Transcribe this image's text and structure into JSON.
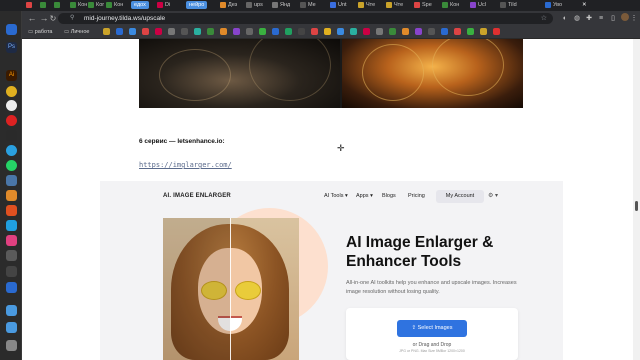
{
  "browser": {
    "tabs": [
      {
        "label": "Кон",
        "color": "#d44"
      },
      {
        "label": "Ког",
        "color": "#3a8a3a"
      },
      {
        "label": "Кон",
        "color": "#3a8a3a"
      },
      {
        "label": "едох",
        "color": "#4a8fe0"
      },
      {
        "label": "Di",
        "color": "#c04"
      },
      {
        "label": "нейро",
        "color": "#4a8fe0"
      },
      {
        "label": "Дез",
        "color": "#e08a2a"
      },
      {
        "label": "ups",
        "color": "#666"
      },
      {
        "label": "Янд",
        "color": "#777"
      },
      {
        "label": "Ме",
        "color": "#555"
      },
      {
        "label": "Unt",
        "color": "#3a6ee0"
      },
      {
        "label": "Чте",
        "color": "#caa32a"
      },
      {
        "label": "Чте",
        "color": "#caa32a"
      },
      {
        "label": "Spe",
        "color": "#d44"
      },
      {
        "label": "Кон",
        "color": "#3a8a3a"
      },
      {
        "label": "Ucl",
        "color": "#8844cc"
      },
      {
        "label": "Tild",
        "color": "#555"
      },
      {
        "label": "Уво",
        "color": "#2a6ad0"
      }
    ],
    "url": "mid-journey.tilda.ws/upscale",
    "bookmarks": [
      "работа",
      "Личное"
    ]
  },
  "page": {
    "heading": "6 сервис — letsenhance.io:",
    "link": "https://imglarger.com/",
    "screenshot": {
      "logo": "AI. IMAGE ENLARGER",
      "nav": [
        "AI Tools ▾",
        "Apps ▾",
        "Blogs",
        "Pricing"
      ],
      "account": "My Account",
      "lang": "⚙ ▾",
      "title": "AI Image Enlarger & Enhancer Tools",
      "subtitle": "All-in-one AI toolkits help you enhance and upscale images. Increases image resolution without losing quality.",
      "select_button": "⇪  Select Images",
      "drop_text": "or Drag and Drop",
      "formats": "JPG or PNG. Max Size 5MBor 1200×1200"
    }
  }
}
